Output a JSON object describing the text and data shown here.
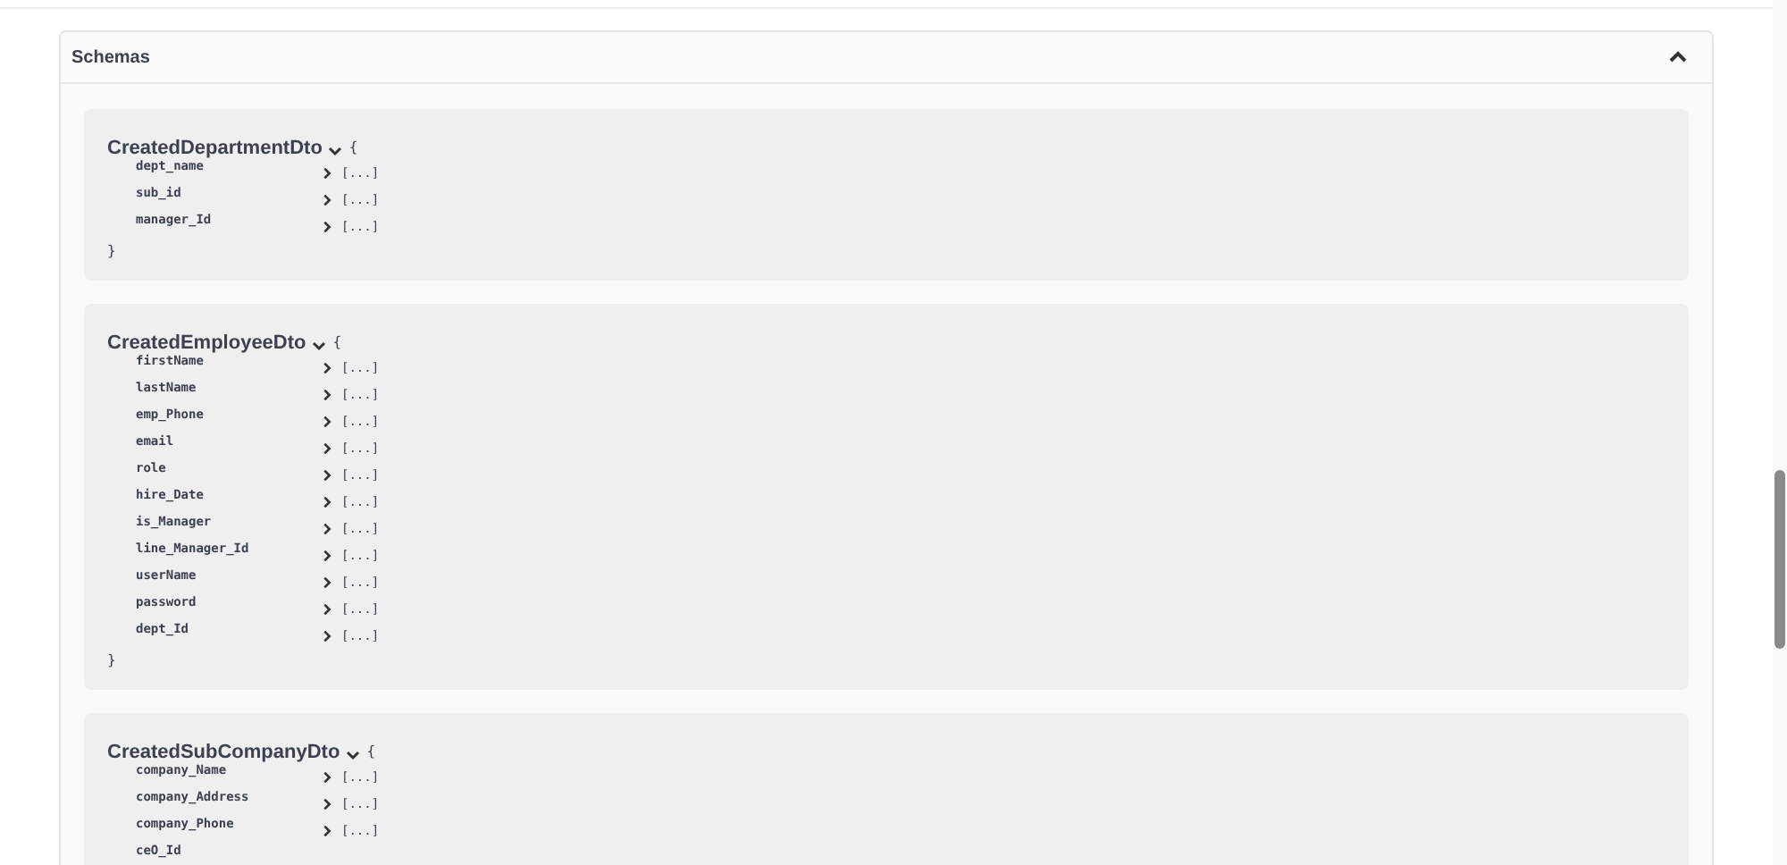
{
  "section": {
    "title": "Schemas",
    "expanded": true
  },
  "schemas": [
    {
      "name": "CreatedDepartmentDto",
      "expanded": true,
      "open_brace": "{",
      "close_brace": "}",
      "properties": [
        {
          "name": "dept_name",
          "expanded": false,
          "value": "[...]"
        },
        {
          "name": "sub_id",
          "expanded": false,
          "value": "[...]"
        },
        {
          "name": "manager_Id",
          "expanded": false,
          "value": "[...]"
        }
      ]
    },
    {
      "name": "CreatedEmployeeDto",
      "expanded": true,
      "open_brace": "{",
      "close_brace": "}",
      "properties": [
        {
          "name": "firstName",
          "expanded": false,
          "value": "[...]"
        },
        {
          "name": "lastName",
          "expanded": false,
          "value": "[...]"
        },
        {
          "name": "emp_Phone",
          "expanded": false,
          "value": "[...]"
        },
        {
          "name": "email",
          "expanded": false,
          "value": "[...]"
        },
        {
          "name": "role",
          "expanded": false,
          "value": "[...]"
        },
        {
          "name": "hire_Date",
          "expanded": false,
          "value": "[...]"
        },
        {
          "name": "is_Manager",
          "expanded": false,
          "value": "[...]"
        },
        {
          "name": "line_Manager_Id",
          "expanded": false,
          "value": "[...]"
        },
        {
          "name": "userName",
          "expanded": false,
          "value": "[...]"
        },
        {
          "name": "password",
          "expanded": false,
          "value": "[...]"
        },
        {
          "name": "dept_Id",
          "expanded": false,
          "value": "[...]"
        }
      ]
    },
    {
      "name": "CreatedSubCompanyDto",
      "expanded": true,
      "open_brace": "{",
      "properties": [
        {
          "name": "company_Name",
          "expanded": false,
          "value": "[...]"
        },
        {
          "name": "company_Address",
          "expanded": false,
          "value": "[...]"
        },
        {
          "name": "company_Phone",
          "expanded": false,
          "value": "[...]"
        },
        {
          "name": "ceO_Id"
        }
      ]
    }
  ]
}
